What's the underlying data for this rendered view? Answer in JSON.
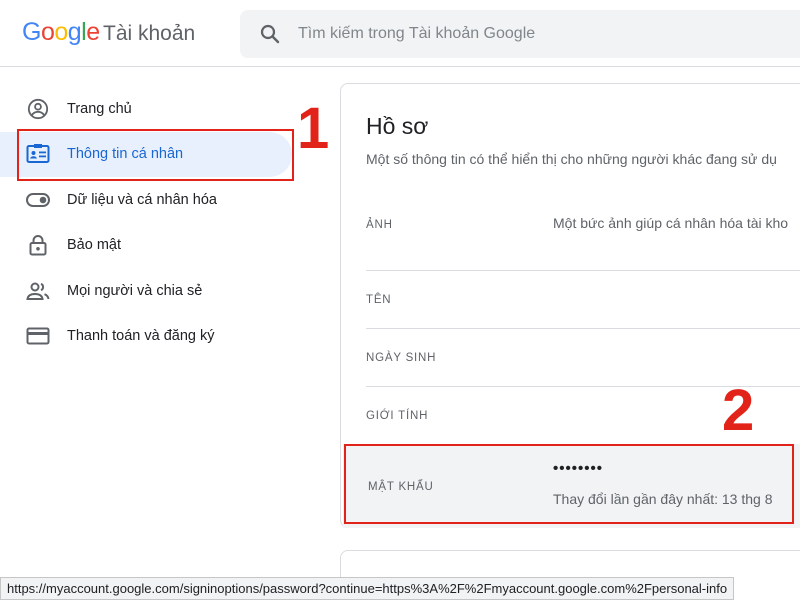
{
  "header": {
    "logo_letters": [
      {
        "ch": "G",
        "color": "#4285f4"
      },
      {
        "ch": "o",
        "color": "#ea4335"
      },
      {
        "ch": "o",
        "color": "#fbbc05"
      },
      {
        "ch": "g",
        "color": "#4285f4"
      },
      {
        "ch": "l",
        "color": "#34a853"
      },
      {
        "ch": "e",
        "color": "#ea4335"
      }
    ],
    "product_name": "Tài khoản",
    "search_placeholder": "Tìm kiếm trong Tài khoản Google"
  },
  "sidebar": {
    "items": [
      {
        "label": "Trang chủ",
        "icon": "account-circle-icon"
      },
      {
        "label": "Thông tin cá nhân",
        "icon": "id-card-icon",
        "active": true
      },
      {
        "label": "Dữ liệu và cá nhân hóa",
        "icon": "toggle-icon"
      },
      {
        "label": "Bảo mật",
        "icon": "lock-icon"
      },
      {
        "label": "Mọi người và chia sẻ",
        "icon": "people-icon"
      },
      {
        "label": "Thanh toán và đăng ký",
        "icon": "credit-card-icon"
      }
    ]
  },
  "annotations": {
    "marker1": "1",
    "marker2": "2",
    "color": "#e2231a"
  },
  "profile": {
    "title": "Hồ sơ",
    "subtitle": "Một số thông tin có thể hiển thị cho những người khác đang sử dụ",
    "rows": {
      "photo_label": "ẢNH",
      "photo_value": "Một bức ảnh giúp cá nhân hóa tài kho",
      "name_label": "TÊN",
      "birthday_label": "NGÀY SINH",
      "gender_label": "GIỚI TÍNH",
      "password_label": "MẬT KHẨU",
      "password_value": "••••••••",
      "password_changed": "Thay đổi lần gần đây nhất: 13 thg 8"
    }
  },
  "statusbar": {
    "url": "https://myaccount.google.com/signinoptions/password?continue=https%3A%2F%2Fmyaccount.google.com%2Fpersonal-info"
  }
}
